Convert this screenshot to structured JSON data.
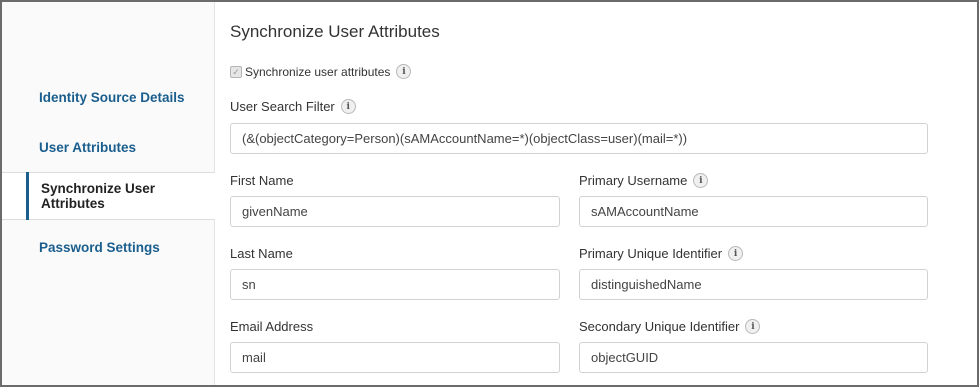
{
  "sidebar": {
    "items": [
      {
        "label": "Identity Source Details",
        "active": false
      },
      {
        "label": "User Attributes",
        "active": false
      },
      {
        "label": "Synchronize User Attributes",
        "active": true
      },
      {
        "label": "Password Settings",
        "active": false
      }
    ]
  },
  "main": {
    "title": "Synchronize User Attributes",
    "sync_checkbox": {
      "label": "Synchronize user attributes",
      "checked": true,
      "disabled": true
    },
    "info_glyph": "i",
    "search_filter": {
      "label": "User Search Filter",
      "value": "(&(objectCategory=Person)(sAMAccountName=*)(objectClass=user)(mail=*))"
    },
    "fields": {
      "first_name": {
        "label": "First Name",
        "value": "givenName"
      },
      "primary_username": {
        "label": "Primary Username",
        "value": "sAMAccountName"
      },
      "last_name": {
        "label": "Last Name",
        "value": "sn"
      },
      "primary_unique_id": {
        "label": "Primary Unique Identifier",
        "value": "distinguishedName"
      },
      "email_address": {
        "label": "Email Address",
        "value": "mail"
      },
      "secondary_unique_id": {
        "label": "Secondary Unique Identifier",
        "value": "objectGUID"
      }
    }
  },
  "colors": {
    "link": "#1a5e8e",
    "active_indicator": "#1a5e8e",
    "frame_border": "#6b6b6b"
  }
}
